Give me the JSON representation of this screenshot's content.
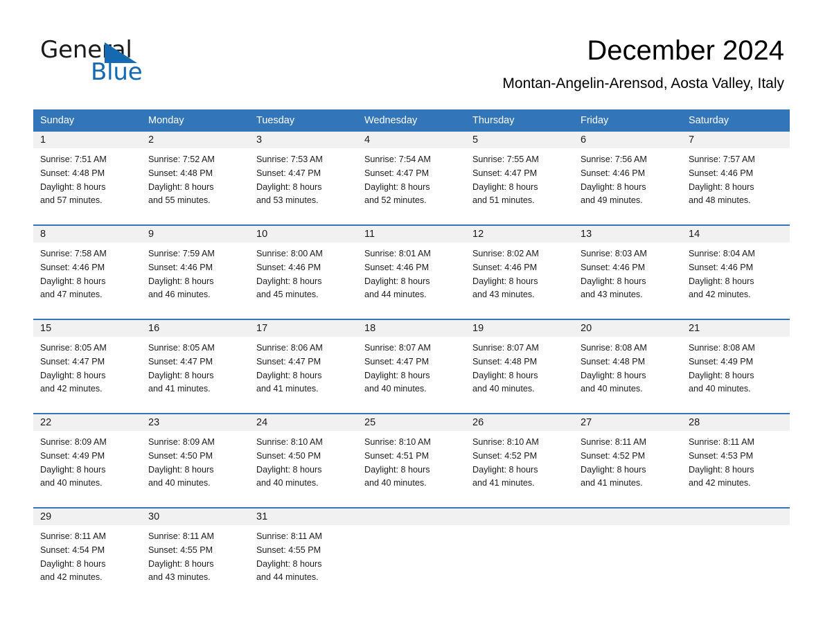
{
  "brand": {
    "name_part1": "General",
    "name_part2": "Blue",
    "logo_icon": "triangle-logo-icon",
    "accent_color": "#1569b0"
  },
  "header": {
    "month_title": "December 2024",
    "location": "Montan-Angelin-Arensod, Aosta Valley, Italy"
  },
  "calendar": {
    "header_bg_color": "#3275b9",
    "date_band_color": "#f1f1f1",
    "weekdays": [
      "Sunday",
      "Monday",
      "Tuesday",
      "Wednesday",
      "Thursday",
      "Friday",
      "Saturday"
    ],
    "weeks": [
      [
        {
          "date": "1",
          "sunrise": "Sunrise: 7:51 AM",
          "sunset": "Sunset: 4:48 PM",
          "daylight_line1": "Daylight: 8 hours",
          "daylight_line2": "and 57 minutes."
        },
        {
          "date": "2",
          "sunrise": "Sunrise: 7:52 AM",
          "sunset": "Sunset: 4:48 PM",
          "daylight_line1": "Daylight: 8 hours",
          "daylight_line2": "and 55 minutes."
        },
        {
          "date": "3",
          "sunrise": "Sunrise: 7:53 AM",
          "sunset": "Sunset: 4:47 PM",
          "daylight_line1": "Daylight: 8 hours",
          "daylight_line2": "and 53 minutes."
        },
        {
          "date": "4",
          "sunrise": "Sunrise: 7:54 AM",
          "sunset": "Sunset: 4:47 PM",
          "daylight_line1": "Daylight: 8 hours",
          "daylight_line2": "and 52 minutes."
        },
        {
          "date": "5",
          "sunrise": "Sunrise: 7:55 AM",
          "sunset": "Sunset: 4:47 PM",
          "daylight_line1": "Daylight: 8 hours",
          "daylight_line2": "and 51 minutes."
        },
        {
          "date": "6",
          "sunrise": "Sunrise: 7:56 AM",
          "sunset": "Sunset: 4:46 PM",
          "daylight_line1": "Daylight: 8 hours",
          "daylight_line2": "and 49 minutes."
        },
        {
          "date": "7",
          "sunrise": "Sunrise: 7:57 AM",
          "sunset": "Sunset: 4:46 PM",
          "daylight_line1": "Daylight: 8 hours",
          "daylight_line2": "and 48 minutes."
        }
      ],
      [
        {
          "date": "8",
          "sunrise": "Sunrise: 7:58 AM",
          "sunset": "Sunset: 4:46 PM",
          "daylight_line1": "Daylight: 8 hours",
          "daylight_line2": "and 47 minutes."
        },
        {
          "date": "9",
          "sunrise": "Sunrise: 7:59 AM",
          "sunset": "Sunset: 4:46 PM",
          "daylight_line1": "Daylight: 8 hours",
          "daylight_line2": "and 46 minutes."
        },
        {
          "date": "10",
          "sunrise": "Sunrise: 8:00 AM",
          "sunset": "Sunset: 4:46 PM",
          "daylight_line1": "Daylight: 8 hours",
          "daylight_line2": "and 45 minutes."
        },
        {
          "date": "11",
          "sunrise": "Sunrise: 8:01 AM",
          "sunset": "Sunset: 4:46 PM",
          "daylight_line1": "Daylight: 8 hours",
          "daylight_line2": "and 44 minutes."
        },
        {
          "date": "12",
          "sunrise": "Sunrise: 8:02 AM",
          "sunset": "Sunset: 4:46 PM",
          "daylight_line1": "Daylight: 8 hours",
          "daylight_line2": "and 43 minutes."
        },
        {
          "date": "13",
          "sunrise": "Sunrise: 8:03 AM",
          "sunset": "Sunset: 4:46 PM",
          "daylight_line1": "Daylight: 8 hours",
          "daylight_line2": "and 43 minutes."
        },
        {
          "date": "14",
          "sunrise": "Sunrise: 8:04 AM",
          "sunset": "Sunset: 4:46 PM",
          "daylight_line1": "Daylight: 8 hours",
          "daylight_line2": "and 42 minutes."
        }
      ],
      [
        {
          "date": "15",
          "sunrise": "Sunrise: 8:05 AM",
          "sunset": "Sunset: 4:47 PM",
          "daylight_line1": "Daylight: 8 hours",
          "daylight_line2": "and 42 minutes."
        },
        {
          "date": "16",
          "sunrise": "Sunrise: 8:05 AM",
          "sunset": "Sunset: 4:47 PM",
          "daylight_line1": "Daylight: 8 hours",
          "daylight_line2": "and 41 minutes."
        },
        {
          "date": "17",
          "sunrise": "Sunrise: 8:06 AM",
          "sunset": "Sunset: 4:47 PM",
          "daylight_line1": "Daylight: 8 hours",
          "daylight_line2": "and 41 minutes."
        },
        {
          "date": "18",
          "sunrise": "Sunrise: 8:07 AM",
          "sunset": "Sunset: 4:47 PM",
          "daylight_line1": "Daylight: 8 hours",
          "daylight_line2": "and 40 minutes."
        },
        {
          "date": "19",
          "sunrise": "Sunrise: 8:07 AM",
          "sunset": "Sunset: 4:48 PM",
          "daylight_line1": "Daylight: 8 hours",
          "daylight_line2": "and 40 minutes."
        },
        {
          "date": "20",
          "sunrise": "Sunrise: 8:08 AM",
          "sunset": "Sunset: 4:48 PM",
          "daylight_line1": "Daylight: 8 hours",
          "daylight_line2": "and 40 minutes."
        },
        {
          "date": "21",
          "sunrise": "Sunrise: 8:08 AM",
          "sunset": "Sunset: 4:49 PM",
          "daylight_line1": "Daylight: 8 hours",
          "daylight_line2": "and 40 minutes."
        }
      ],
      [
        {
          "date": "22",
          "sunrise": "Sunrise: 8:09 AM",
          "sunset": "Sunset: 4:49 PM",
          "daylight_line1": "Daylight: 8 hours",
          "daylight_line2": "and 40 minutes."
        },
        {
          "date": "23",
          "sunrise": "Sunrise: 8:09 AM",
          "sunset": "Sunset: 4:50 PM",
          "daylight_line1": "Daylight: 8 hours",
          "daylight_line2": "and 40 minutes."
        },
        {
          "date": "24",
          "sunrise": "Sunrise: 8:10 AM",
          "sunset": "Sunset: 4:50 PM",
          "daylight_line1": "Daylight: 8 hours",
          "daylight_line2": "and 40 minutes."
        },
        {
          "date": "25",
          "sunrise": "Sunrise: 8:10 AM",
          "sunset": "Sunset: 4:51 PM",
          "daylight_line1": "Daylight: 8 hours",
          "daylight_line2": "and 40 minutes."
        },
        {
          "date": "26",
          "sunrise": "Sunrise: 8:10 AM",
          "sunset": "Sunset: 4:52 PM",
          "daylight_line1": "Daylight: 8 hours",
          "daylight_line2": "and 41 minutes."
        },
        {
          "date": "27",
          "sunrise": "Sunrise: 8:11 AM",
          "sunset": "Sunset: 4:52 PM",
          "daylight_line1": "Daylight: 8 hours",
          "daylight_line2": "and 41 minutes."
        },
        {
          "date": "28",
          "sunrise": "Sunrise: 8:11 AM",
          "sunset": "Sunset: 4:53 PM",
          "daylight_line1": "Daylight: 8 hours",
          "daylight_line2": "and 42 minutes."
        }
      ],
      [
        {
          "date": "29",
          "sunrise": "Sunrise: 8:11 AM",
          "sunset": "Sunset: 4:54 PM",
          "daylight_line1": "Daylight: 8 hours",
          "daylight_line2": "and 42 minutes."
        },
        {
          "date": "30",
          "sunrise": "Sunrise: 8:11 AM",
          "sunset": "Sunset: 4:55 PM",
          "daylight_line1": "Daylight: 8 hours",
          "daylight_line2": "and 43 minutes."
        },
        {
          "date": "31",
          "sunrise": "Sunrise: 8:11 AM",
          "sunset": "Sunset: 4:55 PM",
          "daylight_line1": "Daylight: 8 hours",
          "daylight_line2": "and 44 minutes."
        },
        {
          "date": "",
          "sunrise": "",
          "sunset": "",
          "daylight_line1": "",
          "daylight_line2": ""
        },
        {
          "date": "",
          "sunrise": "",
          "sunset": "",
          "daylight_line1": "",
          "daylight_line2": ""
        },
        {
          "date": "",
          "sunrise": "",
          "sunset": "",
          "daylight_line1": "",
          "daylight_line2": ""
        },
        {
          "date": "",
          "sunrise": "",
          "sunset": "",
          "daylight_line1": "",
          "daylight_line2": ""
        }
      ]
    ]
  }
}
